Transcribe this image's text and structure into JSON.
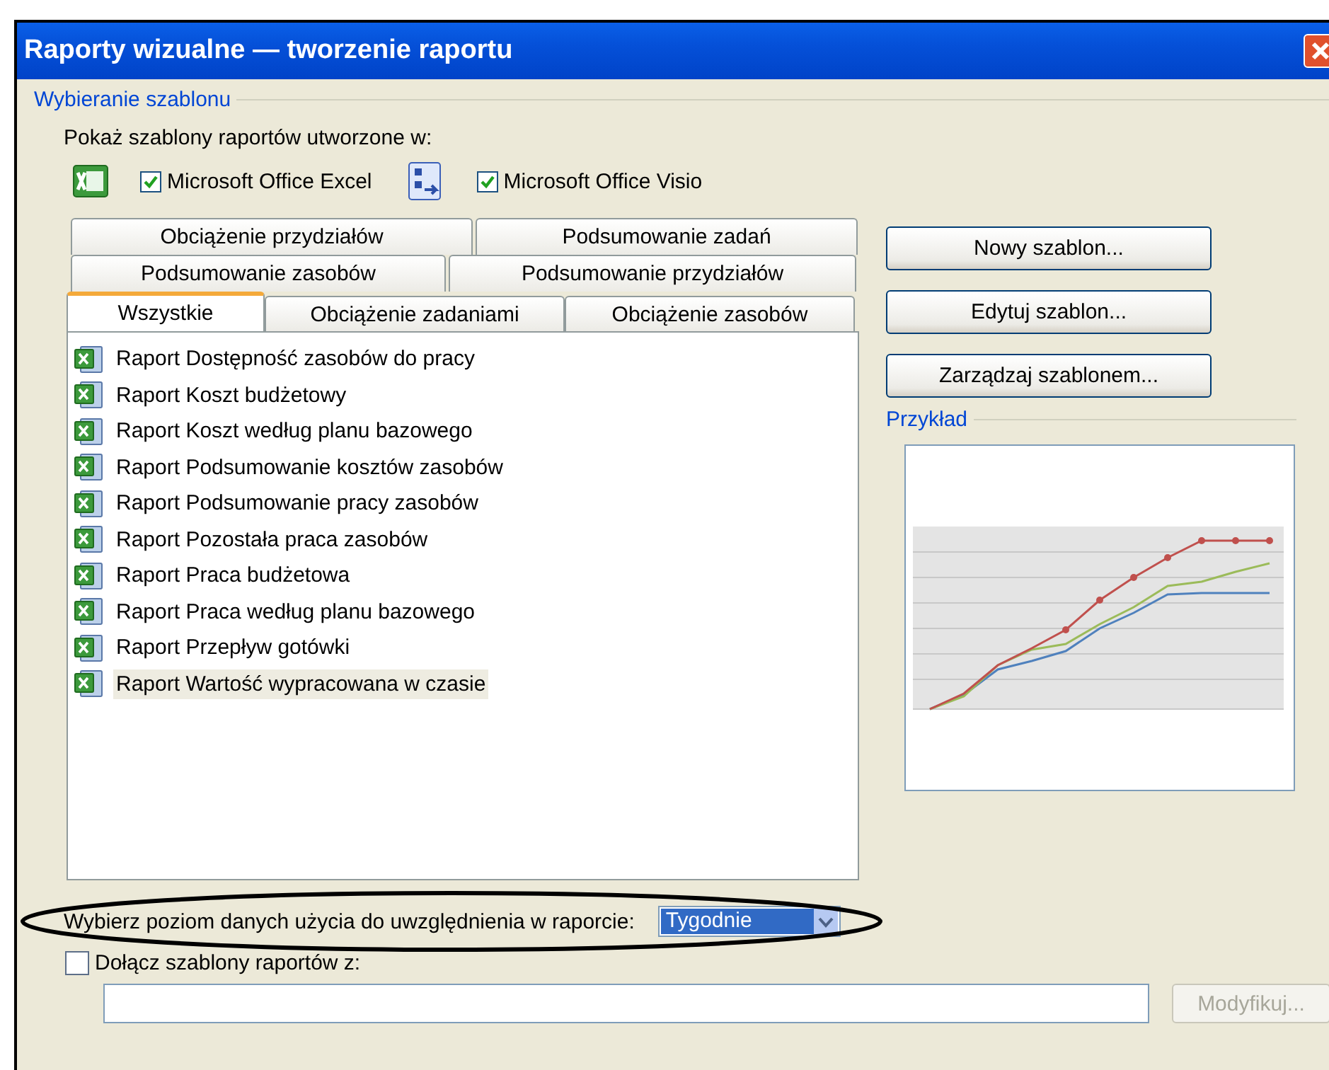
{
  "window": {
    "title": "Raporty wizualne — tworzenie raportu"
  },
  "template_group": {
    "legend": "Wybieranie szablonu",
    "show_label": "Pokaż szablony raportów utworzone w:",
    "sources": [
      {
        "kind": "excel",
        "label": "Microsoft Office Excel",
        "checked": true
      },
      {
        "kind": "visio",
        "label": "Microsoft Office Visio",
        "checked": true
      }
    ]
  },
  "tab_rows": [
    {
      "tabs": [
        {
          "label": "Obciążenie przydziałów",
          "selected": false
        },
        {
          "label": "Podsumowanie zadań",
          "selected": false
        }
      ]
    },
    {
      "tabs": [
        {
          "label": "Podsumowanie zasobów",
          "selected": false
        },
        {
          "label": "Podsumowanie przydziałów",
          "selected": false
        }
      ]
    },
    {
      "tabs": [
        {
          "label": "Wszystkie",
          "selected": true
        },
        {
          "label": "Obciążenie zadaniami",
          "selected": false
        },
        {
          "label": "Obciążenie zasobów",
          "selected": false
        }
      ]
    }
  ],
  "reports": [
    {
      "label": "Raport Dostępność zasobów do pracy",
      "selected": false
    },
    {
      "label": "Raport Koszt budżetowy",
      "selected": false
    },
    {
      "label": "Raport Koszt według planu bazowego",
      "selected": false
    },
    {
      "label": "Raport Podsumowanie kosztów zasobów",
      "selected": false
    },
    {
      "label": "Raport Podsumowanie pracy zasobów",
      "selected": false
    },
    {
      "label": "Raport Pozostała praca zasobów",
      "selected": false
    },
    {
      "label": "Raport Praca budżetowa",
      "selected": false
    },
    {
      "label": "Raport Praca według planu bazowego",
      "selected": false
    },
    {
      "label": "Raport Przepływ gotówki",
      "selected": false
    },
    {
      "label": "Raport Wartość wypracowana w czasie",
      "selected": true
    }
  ],
  "buttons": [
    "Nowy szablon...",
    "Edytuj szablon...",
    "Zarządzaj szablonem..."
  ],
  "preview": {
    "legend": "Przykład"
  },
  "level_select": {
    "label": "Wybierz poziom danych użycia do uwzględnienia w raporcie:",
    "value": "Tygodnie"
  },
  "include": {
    "label": "Dołącz szablony raportów z:",
    "checked": false
  },
  "modify_button": {
    "label": "Modyfikuj...",
    "disabled": true
  }
}
